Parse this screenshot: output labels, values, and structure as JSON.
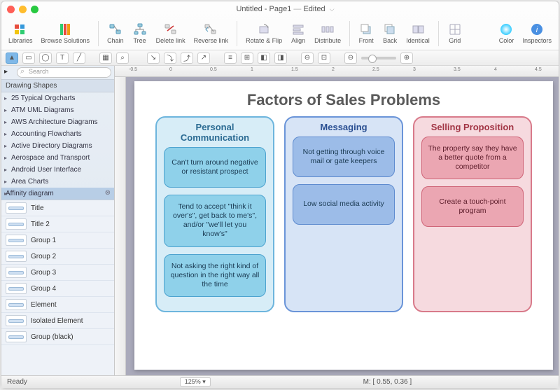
{
  "titlebar": {
    "doc": "Untitled",
    "page": "Page1",
    "state": "Edited"
  },
  "toolbar": {
    "libraries": "Libraries",
    "browse": "Browse Solutions",
    "chain": "Chain",
    "tree": "Tree",
    "deletelink": "Delete link",
    "reverselink": "Reverse link",
    "rotateflip": "Rotate & Flip",
    "align": "Align",
    "distribute": "Distribute",
    "front": "Front",
    "back": "Back",
    "identical": "Identical",
    "grid": "Grid",
    "color": "Color",
    "inspectors": "Inspectors"
  },
  "ruler_ticks": [
    "-0.5",
    "0",
    "0.5",
    "1",
    "1.5",
    "2",
    "2.5",
    "3",
    "3.5",
    "4",
    "4.5"
  ],
  "sidebar": {
    "search_placeholder": "Search",
    "header": "Drawing Shapes",
    "cats": [
      "25 Typical Orgcharts",
      "ATM UML Diagrams",
      "AWS Architecture Diagrams",
      "Accounting Flowcharts",
      "Active Directory Diagrams",
      "Aerospace and Transport",
      "Android User Interface",
      "Area Charts"
    ],
    "selected": "Affinity diagram",
    "shapes": [
      "Title",
      "Title 2",
      "Group 1",
      "Group 2",
      "Group 3",
      "Group 4",
      "Element",
      "Isolated Element",
      "Group (black)"
    ]
  },
  "diagram": {
    "title": "Factors of Sales Problems",
    "groups": [
      {
        "name": "Personal Communication",
        "cards": [
          "Can't turn around negative or resistant prospect",
          "Tend  to accept \"think it over's\", get back to me's\", and/or \"we'll let you know's\"",
          "Not asking the right kind of question in the right way all the time"
        ]
      },
      {
        "name": "Messaging",
        "cards": [
          "Not getting through voice mail or gate keepers",
          "Low social media activity"
        ]
      },
      {
        "name": "Selling Proposition",
        "cards": [
          "The property say they have a better quote from a competitor",
          "Create a touch-point program"
        ]
      }
    ]
  },
  "status": {
    "ready": "Ready",
    "zoom": "125%",
    "zoom_arrow": "▾",
    "coords": "M: [ 0.55, 0.36 ]"
  }
}
